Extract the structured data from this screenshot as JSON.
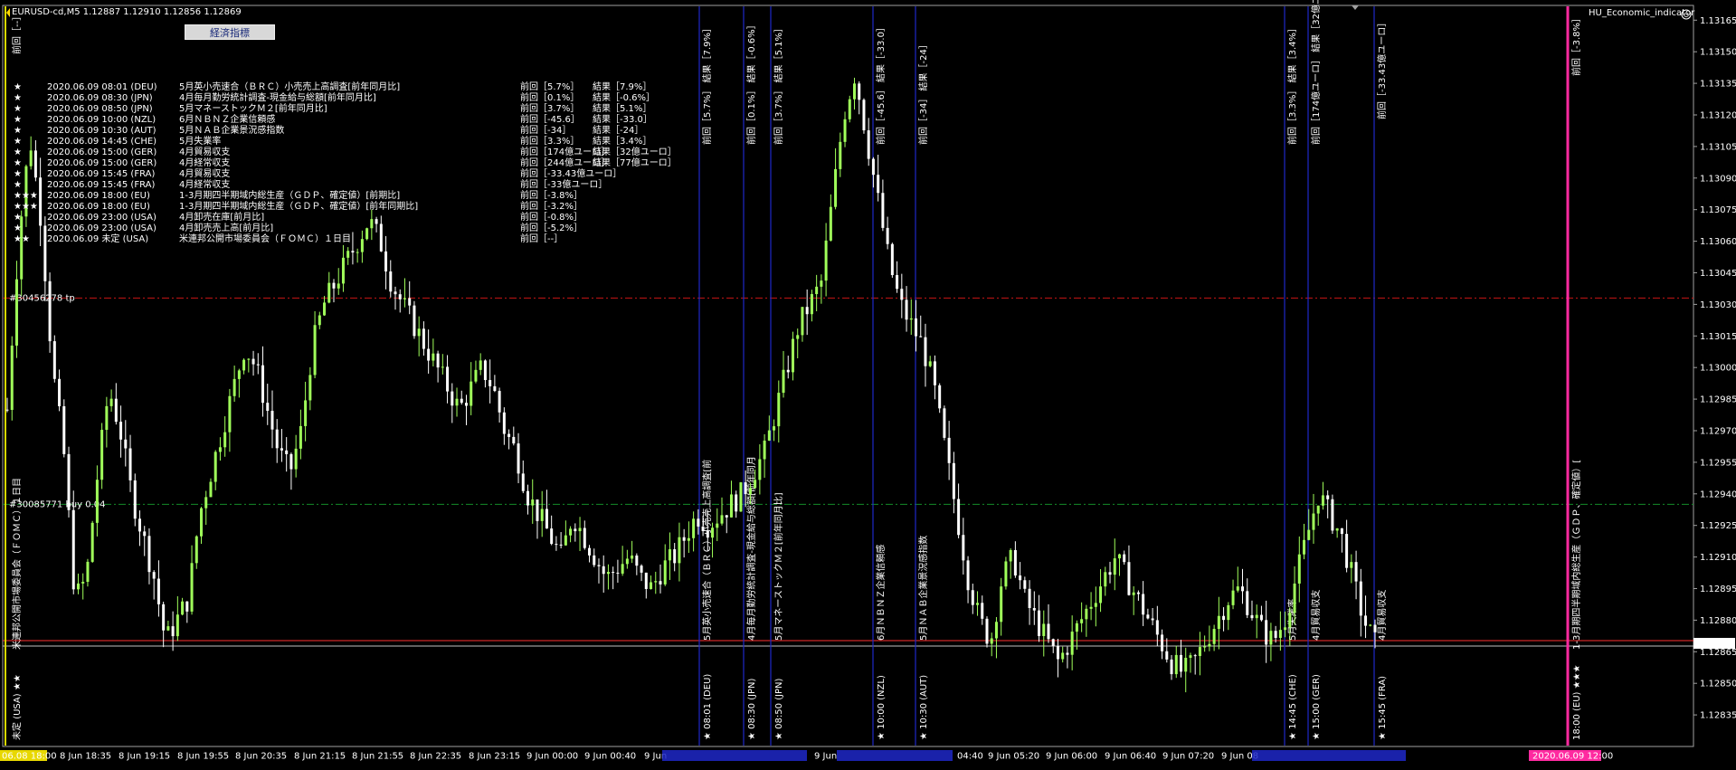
{
  "window": {
    "symbol_line": "EURUSD-cd,M5  1.12887 1.12910 1.12856 1.12869",
    "indicator_name": "HU_Economic_indicator",
    "indicator_button": "経済指標"
  },
  "colors": {
    "background": "#000000",
    "bull": "#a0ff5a",
    "bear": "#ffffff",
    "event_line": "#1e28c8",
    "event_text_blue": "#1e8cff",
    "result_red": "#ff2020",
    "high_importance": "#ff9aa2",
    "fomc": "#d8d800",
    "tp_line": "#c81414",
    "buy_line": "#148c28",
    "current_price_line": "#ff3030",
    "magenta": "#ff2aa0"
  },
  "chart_data": {
    "type": "candlestick",
    "symbol": "EURUSD-cd",
    "timeframe": "M5",
    "ohlc_header": {
      "open": 1.12887,
      "high": 1.1291,
      "low": 1.12856,
      "close": 1.12869
    },
    "price_axis": {
      "min": 1.1282,
      "max": 1.13172,
      "ticks": [
        "1.13165",
        "1.13150",
        "1.13135",
        "1.13120",
        "1.13105",
        "1.13090",
        "1.13075",
        "1.13060",
        "1.13045",
        "1.13030",
        "1.13015",
        "1.13000",
        "1.12985",
        "1.12970",
        "1.12955",
        "1.12940",
        "1.12925",
        "1.12910",
        "1.12895",
        "1.12880",
        "1.12865",
        "1.12850",
        "1.12835"
      ],
      "current_price": "1.12869"
    },
    "time_axis": {
      "labels": [
        "06.08 18:00",
        "8 Jun 18:35",
        "8 Jun 19:15",
        "8 Jun 19:55",
        "8 Jun 20:35",
        "8 Jun 21:15",
        "8 Jun 21:55",
        "8 Jun 22:35",
        "8 Jun 23:15",
        "9 Jun 00:00",
        "9 Jun 00:40",
        "9 Jun",
        "9 Jun",
        "04:40",
        "9 Jun 05:20",
        "9 Jun 06:00",
        "9 Jun 06:40",
        "9 Jun 07:20",
        "9 Jun 08"
      ],
      "future_label": "2020.06.09 12:00"
    },
    "close_path": [
      1.1298,
      1.1306,
      1.1311,
      1.1307,
      1.13,
      1.1296,
      1.1289,
      1.129,
      1.1295,
      1.1299,
      1.1297,
      1.1294,
      1.1292,
      1.129,
      1.1287,
      1.1288,
      1.1289,
      1.1293,
      1.1295,
      1.1297,
      1.1299,
      1.1301,
      1.13,
      1.1298,
      1.1296,
      1.1295,
      1.1297,
      1.1301,
      1.1303,
      1.1304,
      1.1305,
      1.1306,
      1.1307,
      1.1306,
      1.1304,
      1.1303,
      1.1302,
      1.1301,
      1.13,
      1.1299,
      1.1298,
      1.1299,
      1.13,
      1.1299,
      1.1297,
      1.1296,
      1.1294,
      1.1293,
      1.1292,
      1.1291,
      1.1293,
      1.1292,
      1.1291,
      1.129,
      1.12905,
      1.1291,
      1.129,
      1.12895,
      1.12905,
      1.1291,
      1.1292,
      1.1293,
      1.12925,
      1.1293,
      1.12935,
      1.1294,
      1.1295,
      1.1296,
      1.1298,
      1.13,
      1.1302,
      1.1303,
      1.1304,
      1.1308,
      1.1312,
      1.1314,
      1.1311,
      1.1308,
      1.1305,
      1.1303,
      1.1302,
      1.1301,
      1.1299,
      1.1296,
      1.1293,
      1.129,
      1.1288,
      1.1287,
      1.129,
      1.1291,
      1.1289,
      1.1288,
      1.1287,
      1.1286,
      1.1287,
      1.1288,
      1.1289,
      1.129,
      1.1291,
      1.129,
      1.1289,
      1.1288,
      1.1287,
      1.1286,
      1.12855,
      1.1286,
      1.1287,
      1.1288,
      1.1289,
      1.12895,
      1.12885,
      1.12875,
      1.1287,
      1.1288,
      1.129,
      1.1292,
      1.1294,
      1.1293,
      1.1292,
      1.129,
      1.1288,
      1.12869
    ],
    "levels": [
      {
        "name": "tp",
        "label": "#30456278 tp",
        "price": 1.13033,
        "color": "#c81414"
      },
      {
        "name": "buy",
        "label": "#30085771 buy 0.04",
        "price": 1.12935,
        "color": "#148c28"
      }
    ]
  },
  "events": [
    {
      "star": "★",
      "datetime": "2020.06.09 08:01 (DEU)",
      "name": "5月英小売速合（ＢＲＣ）小売売上高調査[前年同月比]",
      "prev": "前回［5.7%］",
      "result": "結果［7.9%］",
      "color": "#1e8cff",
      "result_color": "#ff2020"
    },
    {
      "star": "★",
      "datetime": "2020.06.09 08:30 (JPN)",
      "name": "4月毎月勤労統計調査-現金給与総額[前年同月比]",
      "prev": "前回［0.1%］",
      "result": "結果［-0.6%］",
      "color": "#1e8cff",
      "result_color": "#ff2020"
    },
    {
      "star": "★",
      "datetime": "2020.06.09 08:50 (JPN)",
      "name": "5月マネーストックＭ２[前年同月比]",
      "prev": "前回［3.7%］",
      "result": "結果［5.1%］",
      "color": "#1e8cff",
      "result_color": "#ff2020"
    },
    {
      "star": "★",
      "datetime": "2020.06.09 10:00 (NZL)",
      "name": "6月ＮＢＮＺ企業信頼感",
      "prev": "前回［-45.6］",
      "result": "結果［-33.0］",
      "color": "#1e8cff",
      "result_color": "#ff2020"
    },
    {
      "star": "★",
      "datetime": "2020.06.09 10:30 (AUT)",
      "name": "5月ＮＡＢ企業景況感指数",
      "prev": "前回［-34］",
      "result": "結果［-24］",
      "color": "#1e8cff",
      "result_color": "#ff2020"
    },
    {
      "star": "★",
      "datetime": "2020.06.09 14:45 (CHE)",
      "name": "5月失業率",
      "prev": "前回［3.3%］",
      "result": "結果［3.4%］",
      "color": "#1e8cff",
      "result_color": "#ff2020"
    },
    {
      "star": "★",
      "datetime": "2020.06.09 15:00 (GER)",
      "name": "4月貿易収支",
      "prev": "前回［174億ユーロ］",
      "result": "結果［32億ユーロ］",
      "color": "#1e8cff",
      "result_color": "#1e8cff"
    },
    {
      "star": "★",
      "datetime": "2020.06.09 15:00 (GER)",
      "name": "4月経常収支",
      "prev": "前回［244億ユーロ］",
      "result": "結果［77億ユーロ］",
      "color": "#1e8cff",
      "result_color": "#1e8cff"
    },
    {
      "star": "★",
      "datetime": "2020.06.09 15:45 (FRA)",
      "name": "4月貿易収支",
      "prev": "前回［-33.43億ユーロ］",
      "result": "",
      "color": "#1e8cff",
      "result_color": "#ffffff"
    },
    {
      "star": "★",
      "datetime": "2020.06.09 15:45 (FRA)",
      "name": "4月経常収支",
      "prev": "前回［-33億ユーロ］",
      "result": "",
      "color": "#1e8cff",
      "result_color": "#ffffff"
    },
    {
      "star": "★★★",
      "datetime": "2020.06.09 18:00 (EU)",
      "name": "1-3月期四半期域内総生産（ＧＤＰ、確定値）[前期比]",
      "prev": "前回［-3.8%］",
      "result": "",
      "color": "#ff9aa2",
      "result_color": "#ffffff"
    },
    {
      "star": "★★★",
      "datetime": "2020.06.09 18:00 (EU)",
      "name": "1-3月期四半期域内総生産（ＧＤＰ、確定値）[前年同期比]",
      "prev": "前回［-3.2%］",
      "result": "",
      "color": "#ff9aa2",
      "result_color": "#ffffff"
    },
    {
      "star": "★",
      "datetime": "2020.06.09 23:00 (USA)",
      "name": "4月卸売在庫[前月比]",
      "prev": "前回［-0.8%］",
      "result": "",
      "color": "#1e8cff",
      "result_color": "#ffffff"
    },
    {
      "star": "★",
      "datetime": "2020.06.09 23:00 (USA)",
      "name": "4月卸売売上高[前月比]",
      "prev": "前回［-5.2%］",
      "result": "",
      "color": "#1e8cff",
      "result_color": "#ffffff"
    },
    {
      "star": "★★",
      "datetime": "2020.06.09  未定 (USA)",
      "name": "米連邦公開市場委員会（ＦＯＭＣ）１日目",
      "prev": "前回［--］",
      "result": "",
      "color": "#d8d800",
      "result_color": "#ffffff"
    }
  ],
  "event_lines": [
    {
      "time": "08:01 (DEU)",
      "bottom": "★  08:01 (DEU)",
      "name": "5月英小売速合（ＢＲＣ）小売売上高調査[前",
      "top_prev": "前回［5.7%］",
      "top_result": "結果［7.9%］",
      "top_color": "#ff2020"
    },
    {
      "time": "08:30 (JPN)",
      "bottom": "★  08:30 (JPN)",
      "name": "4月毎月勤労統計調査-現金給与総額[前年同月",
      "top_prev": "前回［0.1%］",
      "top_result": "結果［-0.6%］",
      "top_color": "#1e8cff"
    },
    {
      "time": "08:50 (JPN)",
      "bottom": "★  08:50 (JPN)",
      "name": "5月マネーストックＭ２[前年同月比]",
      "top_prev": "前回［3.7%］",
      "top_result": "結果［5.1%］",
      "top_color": "#ff2020"
    },
    {
      "time": "10:00 (NZL)",
      "bottom": "★  10:00 (NZL)",
      "name": "6月ＮＢＮＺ企業信頼感",
      "top_prev": "前回［-45.6］",
      "top_result": "結果［-33.0］",
      "top_color": "#ff2020"
    },
    {
      "time": "10:30 (AUT)",
      "bottom": "★  10:30 (AUT)",
      "name": "5月ＮＡＢ企業景況感指数",
      "top_prev": "前回［-34］",
      "top_result": "結果［-24］",
      "top_color": "#ff2020"
    },
    {
      "time": "14:45 (CHE)",
      "bottom": "★  14:45 (CHE)",
      "name": "5月失業率",
      "top_prev": "前回［3.3%］",
      "top_result": "結果［3.4%］",
      "top_color": "#ff2020"
    },
    {
      "time": "15:00 (GER)",
      "bottom": "★  15:00 (GER)",
      "name": "4月貿易収支",
      "top_prev": "前回［174億ユーロ］",
      "top_result": "結果［32億ユーロ］",
      "top_color": "#1e8cff"
    },
    {
      "time": "15:45 (FRA)",
      "bottom": "★  15:45 (FRA)",
      "name": "4月貿易収支",
      "top_prev": "前回［-33.43億ユーロ］",
      "top_result": "",
      "top_color": "#ffffff"
    }
  ],
  "edge_labels": {
    "left_bottom": "未定 (USA) ★★",
    "left_name": "米連邦公開市場委員会（ＦＯＭＣ）１日目",
    "left_top": "前回［--］",
    "right_bottom": "18:00 (EU) ★★★",
    "right_name": "1-3月期四半期域内総生産（ＧＤＰ、確定値）[",
    "right_top": "前回［-3.8%］"
  }
}
